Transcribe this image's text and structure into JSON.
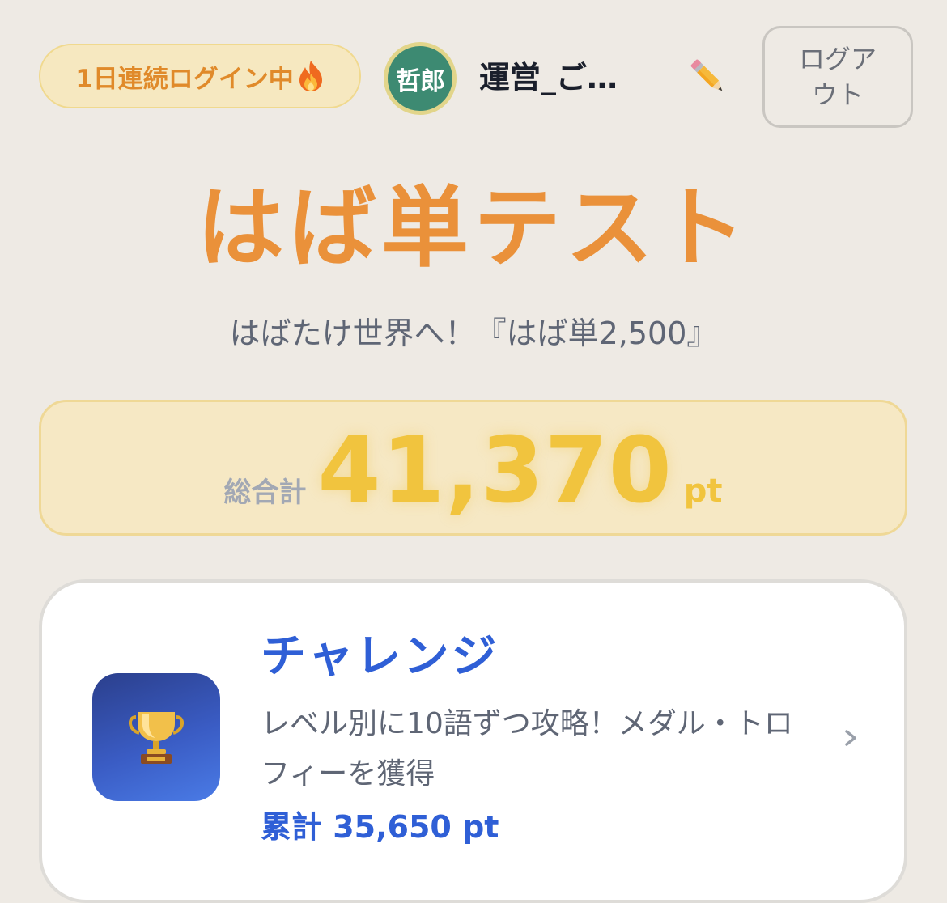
{
  "header": {
    "streak_label": "1日連続ログイン中",
    "streak_icon": "fire-icon",
    "avatar_text": "哲郎",
    "username": "運営_ご…",
    "edit_icon": "pencil-icon",
    "logout_label": "ログアウト"
  },
  "hero": {
    "title": "はば単テスト",
    "subtitle": "はばたけ世界へ！『はば単2,500』"
  },
  "total": {
    "label": "総合計",
    "value": "41,370",
    "unit": "pt"
  },
  "challenge": {
    "icon": "trophy-icon",
    "title": "チャレンジ",
    "description": "レベル別に10語ずつ攻略！メダル・トロフィーを獲得",
    "points": "累計 35,650 pt",
    "chevron": "chevron-right-icon"
  },
  "colors": {
    "background": "#eeeae4",
    "accent_orange": "#ea913a",
    "accent_gold": "#f1c43e",
    "accent_blue": "#2f5fd6",
    "avatar_green": "#3d8a72"
  }
}
